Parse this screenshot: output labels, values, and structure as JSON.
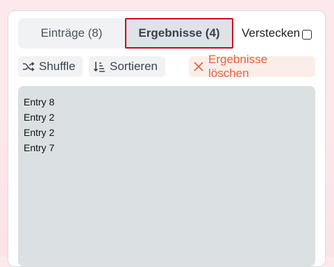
{
  "tabs": {
    "entries_label": "Einträge (8)",
    "results_label": "Ergebnisse (4)"
  },
  "hide": {
    "label": "Verstecken",
    "checked": false
  },
  "toolbar": {
    "shuffle_label": "Shuffle",
    "sort_label": "Sortieren",
    "clear_label": "Ergebnisse löschen"
  },
  "results": [
    "Entry 8",
    "Entry 2",
    "Entry 2",
    "Entry 7"
  ],
  "colors": {
    "highlight_border": "#d0021b",
    "danger": "#e8633f",
    "result_bg": "#dbe0e3"
  },
  "icons": {
    "shuffle": "shuffle-icon",
    "sort": "sort-icon",
    "clear": "close-icon"
  }
}
